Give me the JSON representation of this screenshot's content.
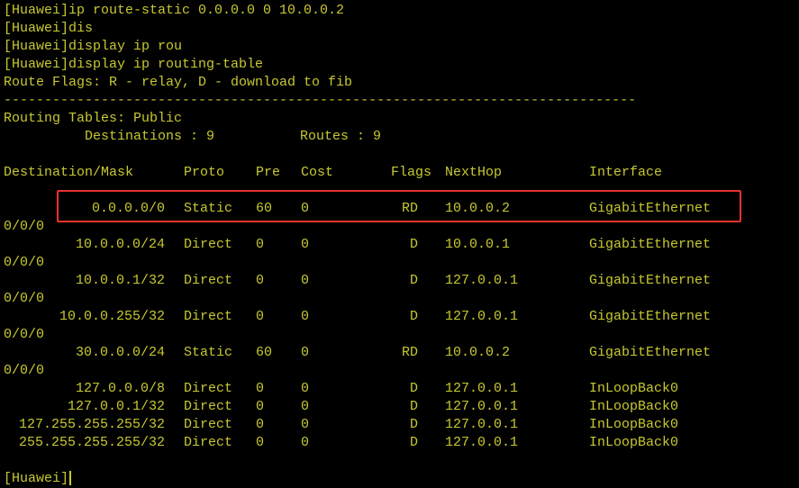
{
  "terminal": {
    "prompt_final": "[Huawei]",
    "commands": [
      "[Huawei]ip route-static 0.0.0.0 0 10.0.0.2",
      "[Huawei]dis",
      "[Huawei]display ip rou",
      "[Huawei]display ip routing-table"
    ],
    "route_flags": "Route Flags: R - relay, D - download to fib",
    "separator": "------------------------------------------------------------------------------",
    "routing_tables": "Routing Tables: Public",
    "destinations_label": "Destinations : 9",
    "routes_label": "Routes : 9",
    "headers": {
      "dest": "Destination/Mask",
      "proto": "Proto",
      "pre": "Pre",
      "cost": "Cost",
      "flags": "Flags",
      "nexthop": "NextHop",
      "interface": "Interface"
    },
    "routes": [
      {
        "dest": "0.0.0.0/0",
        "proto": "Static",
        "pre": "60",
        "cost": "0",
        "flags": "RD",
        "nexthop": "10.0.0.2",
        "interface": "GigabitEthernet",
        "cont": "0/0/0"
      },
      {
        "dest": "10.0.0.0/24",
        "proto": "Direct",
        "pre": "0",
        "cost": "0",
        "flags": "D",
        "nexthop": "10.0.0.1",
        "interface": "GigabitEthernet",
        "cont": "0/0/0"
      },
      {
        "dest": "10.0.0.1/32",
        "proto": "Direct",
        "pre": "0",
        "cost": "0",
        "flags": "D",
        "nexthop": "127.0.0.1",
        "interface": "GigabitEthernet",
        "cont": "0/0/0"
      },
      {
        "dest": "10.0.0.255/32",
        "proto": "Direct",
        "pre": "0",
        "cost": "0",
        "flags": "D",
        "nexthop": "127.0.0.1",
        "interface": "GigabitEthernet",
        "cont": "0/0/0"
      },
      {
        "dest": "30.0.0.0/24",
        "proto": "Static",
        "pre": "60",
        "cost": "0",
        "flags": "RD",
        "nexthop": "10.0.0.2",
        "interface": "GigabitEthernet",
        "cont": "0/0/0"
      },
      {
        "dest": "127.0.0.0/8",
        "proto": "Direct",
        "pre": "0",
        "cost": "0",
        "flags": "D",
        "nexthop": "127.0.0.1",
        "interface": "InLoopBack0",
        "cont": ""
      },
      {
        "dest": "127.0.0.1/32",
        "proto": "Direct",
        "pre": "0",
        "cost": "0",
        "flags": "D",
        "nexthop": "127.0.0.1",
        "interface": "InLoopBack0",
        "cont": ""
      },
      {
        "dest": "127.255.255.255/32",
        "proto": "Direct",
        "pre": "0",
        "cost": "0",
        "flags": "D",
        "nexthop": "127.0.0.1",
        "interface": "InLoopBack0",
        "cont": ""
      },
      {
        "dest": "255.255.255.255/32",
        "proto": "Direct",
        "pre": "0",
        "cost": "0",
        "flags": "D",
        "nexthop": "127.0.0.1",
        "interface": "InLoopBack0",
        "cont": ""
      }
    ]
  },
  "colors": {
    "background": "#000000",
    "text": "#c8c832",
    "highlight_border": "#e8322e"
  }
}
